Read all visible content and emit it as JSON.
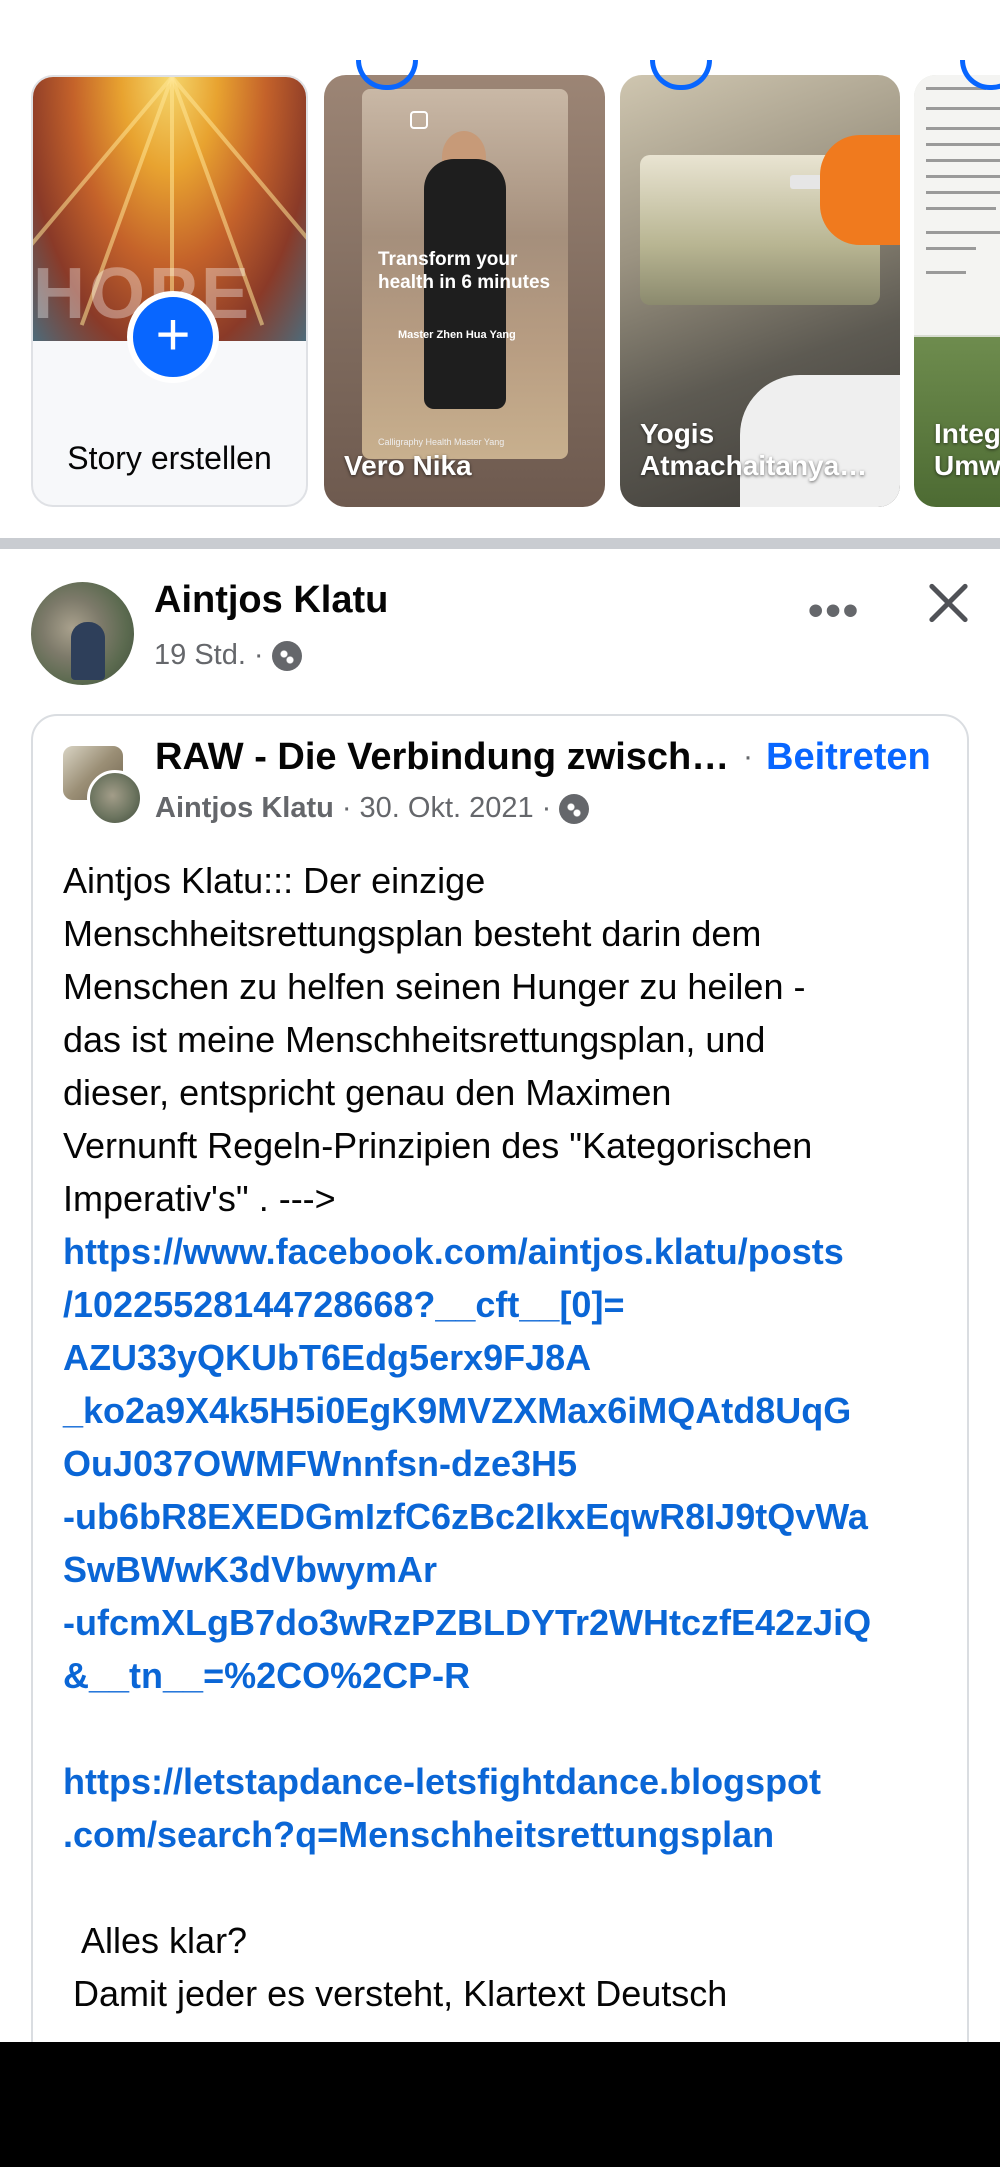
{
  "stories": {
    "create_label": "Story erstellen",
    "items": [
      {
        "name": "Vero Nika",
        "poster_title": "Transform your health in 6 minutes",
        "poster_subtitle": "Master Zhen Hua Yang",
        "poster_footer": "Calligraphy Health Master Yang"
      },
      {
        "name": "Yogis Atmachaitanya…"
      },
      {
        "name": "Integ Umw"
      }
    ]
  },
  "post": {
    "author": "Aintjos Klatu",
    "time": "19 Std.",
    "audience_icon": "globe-icon",
    "more_icon": "more-icon",
    "close_icon": "close-icon",
    "shared": {
      "group_name": "RAW - Die Verbindung zwisch…",
      "join_label": "Beitreten",
      "original_author": "Aintjos Klatu",
      "original_date": "30. Okt. 2021",
      "text_lines": [
        "Aintjos Klatu::: Der einzige",
        "Menschheitsrettungsplan besteht darin dem",
        "Menschen zu helfen seinen Hunger zu heilen -",
        "das ist meine Menschheitsrettungsplan, und",
        "dieser, entspricht genau den Maximen",
        "Vernunft  Regeln-Prinzipien des \"Kategorischen",
        "Imperativ's\" . --->"
      ],
      "link1_lines": [
        "https://www.facebook.com/aintjos.klatu/posts",
        "/10225528144728668?__cft__[0]=",
        "AZU33yQKUbT6Edg5erx9FJ8A",
        "_ko2a9X4k5H5i0EgK9MVZXMax6iMQAtd8UqG",
        "OuJ037OWMFWnnfsn-dze3H5",
        "-ub6bR8EXEDGmIzfC6zBc2IkxEqwR8IJ9tQvWa",
        "SwBWwK3dVbwymAr",
        "-ufcmXLgB7do3wRzPZBLDYTr2WHtczfE42zJiQ",
        "&__tn__=%2CO%2CP-R"
      ],
      "link2_lines": [
        "https://letstapdance-letsfightdance.blogspot",
        ".com/search?q=Menschheitsrettungsplan"
      ],
      "tail_lines": [
        "  Alles klar?",
        " Damit jeder es versteht, Klartext Deutsch"
      ]
    }
  },
  "colors": {
    "accent": "#0866ff",
    "link": "#0a66d6",
    "secondary_text": "#65676b",
    "divider": "#c9ccd1"
  }
}
